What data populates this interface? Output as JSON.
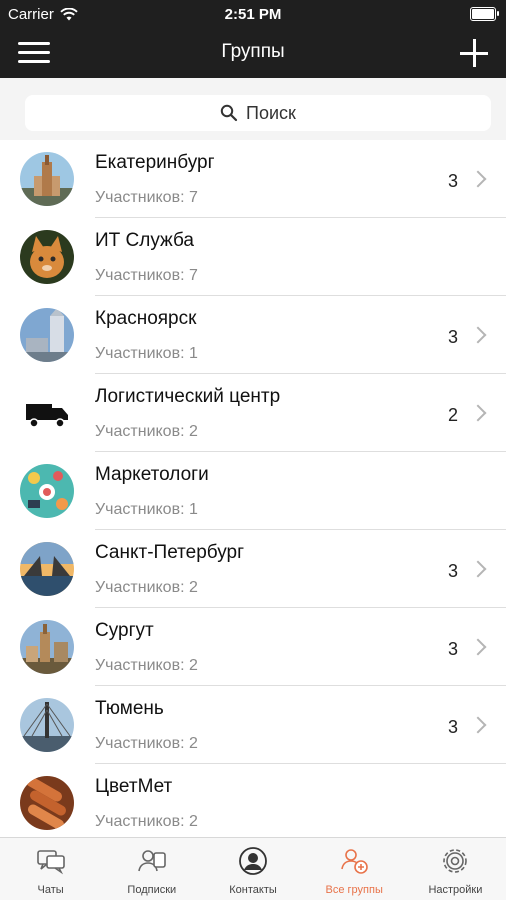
{
  "status_bar": {
    "carrier": "Carrier",
    "time": "2:51 PM"
  },
  "nav": {
    "title": "Группы"
  },
  "search": {
    "placeholder": "Поиск"
  },
  "groups": [
    {
      "name": "Екатеринбург",
      "members": "Участников: 7",
      "count": "3",
      "has_chevron": true
    },
    {
      "name": "ИТ Служба",
      "members": "Участников: 7",
      "count": "",
      "has_chevron": false
    },
    {
      "name": "Красноярск",
      "members": "Участников: 1",
      "count": "3",
      "has_chevron": true
    },
    {
      "name": "Логистический центр",
      "members": "Участников: 2",
      "count": "2",
      "has_chevron": true
    },
    {
      "name": "Маркетологи",
      "members": "Участников: 1",
      "count": "",
      "has_chevron": false
    },
    {
      "name": "Санкт-Петербург",
      "members": "Участников: 2",
      "count": "3",
      "has_chevron": true
    },
    {
      "name": "Сургут",
      "members": "Участников: 2",
      "count": "3",
      "has_chevron": true
    },
    {
      "name": "Тюмень",
      "members": "Участников: 2",
      "count": "3",
      "has_chevron": true
    },
    {
      "name": "ЦветМет",
      "members": "Участников: 2",
      "count": "",
      "has_chevron": false
    }
  ],
  "tabs": [
    {
      "label": "Чаты",
      "icon": "chat-icon",
      "active": false
    },
    {
      "label": "Подписки",
      "icon": "subscriptions-icon",
      "active": false
    },
    {
      "label": "Контакты",
      "icon": "contacts-icon",
      "active": false
    },
    {
      "label": "Все группы",
      "icon": "all-groups-icon",
      "active": true
    },
    {
      "label": "Настройки",
      "icon": "settings-icon",
      "active": false
    }
  ],
  "colors": {
    "accent": "#e8734a",
    "bar": "#1f1f1f"
  }
}
